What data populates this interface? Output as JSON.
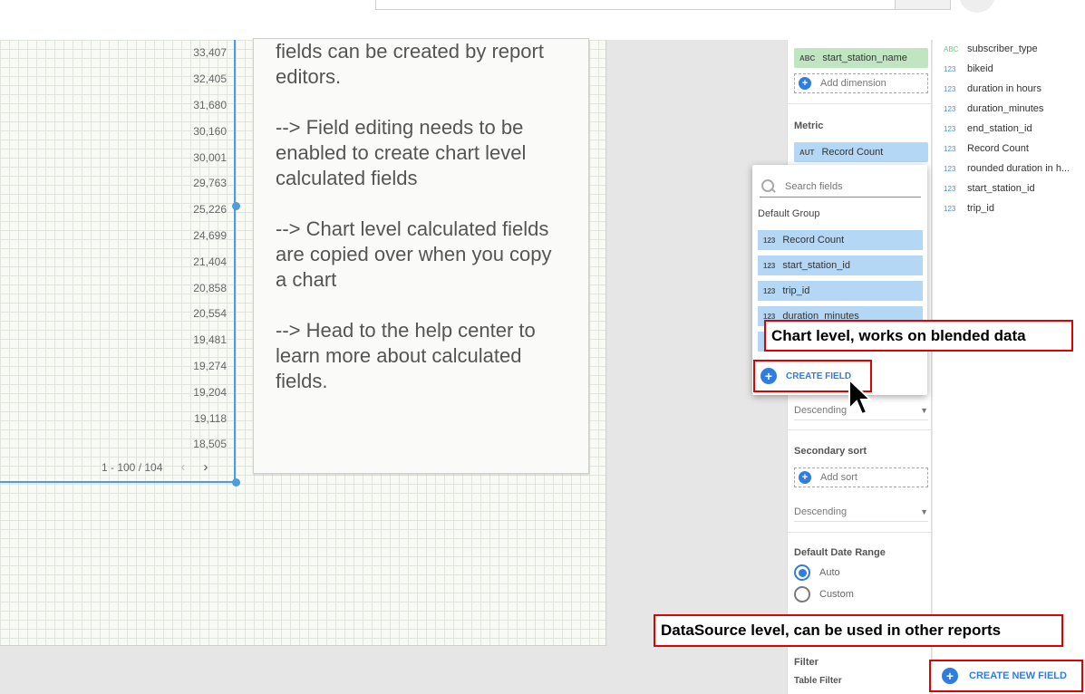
{
  "topbar": {},
  "table": {
    "values": [
      "33,407",
      "32,405",
      "31,680",
      "30,160",
      "30,001",
      "29,763",
      "25,226",
      "24,699",
      "21,404",
      "20,858",
      "20,554",
      "19,481",
      "19,274",
      "19,204",
      "19,118",
      "18,505"
    ],
    "pagination": "1 - 100 / 104",
    "prev_icon": "‹",
    "next_icon": "›"
  },
  "text_box": {
    "paragraphs": [
      "fields can be created by report editors.",
      "--> Field editing needs to be enabled to create chart level calculated fields",
      "--> Chart level calculated fields are copied over when you copy a chart",
      "--> Head to the help center to learn more about calculated fields."
    ]
  },
  "props": {
    "dimension_pill": {
      "type": "ABC",
      "label": "start_station_name"
    },
    "add_dimension": "Add dimension",
    "metric_title": "Metric",
    "metric_pill": {
      "type": "AUT",
      "label": "Record Count"
    },
    "sort_order": "Descending",
    "secondary_sort_title": "Secondary sort",
    "add_sort": "Add sort",
    "secondary_sort_order": "Descending",
    "date_range_title": "Default Date Range",
    "date_range_options": [
      "Auto",
      "Custom"
    ],
    "filter_title": "Filter",
    "table_filter": "Table Filter"
  },
  "popup": {
    "search_placeholder": "Search fields",
    "group_title": "Default Group",
    "items": [
      {
        "type": "123",
        "label": "Record Count"
      },
      {
        "type": "123",
        "label": "start_station_id"
      },
      {
        "type": "123",
        "label": "trip_id"
      },
      {
        "type": "123",
        "label": "duration_minutes"
      }
    ],
    "create_field": "CREATE FIELD"
  },
  "fields": [
    {
      "type": "ABC",
      "label": "subscriber_type"
    },
    {
      "type": "123",
      "label": "bikeid"
    },
    {
      "type": "123",
      "label": "duration in hours"
    },
    {
      "type": "123",
      "label": "duration_minutes"
    },
    {
      "type": "123",
      "label": "end_station_id"
    },
    {
      "type": "123",
      "label": "Record Count"
    },
    {
      "type": "123",
      "label": "rounded duration in h..."
    },
    {
      "type": "123",
      "label": "start_station_id"
    },
    {
      "type": "123",
      "label": "trip_id"
    }
  ],
  "create_new_field": "CREATE NEW FIELD",
  "annotations": {
    "chart_level": "Chart level, works on blended data",
    "datasource_level": "DataSource level, can be used in other reports"
  },
  "colors": {
    "accent": "#2f7de1",
    "annotation_border": "#e00000",
    "chart_border": "#4b9de0"
  }
}
